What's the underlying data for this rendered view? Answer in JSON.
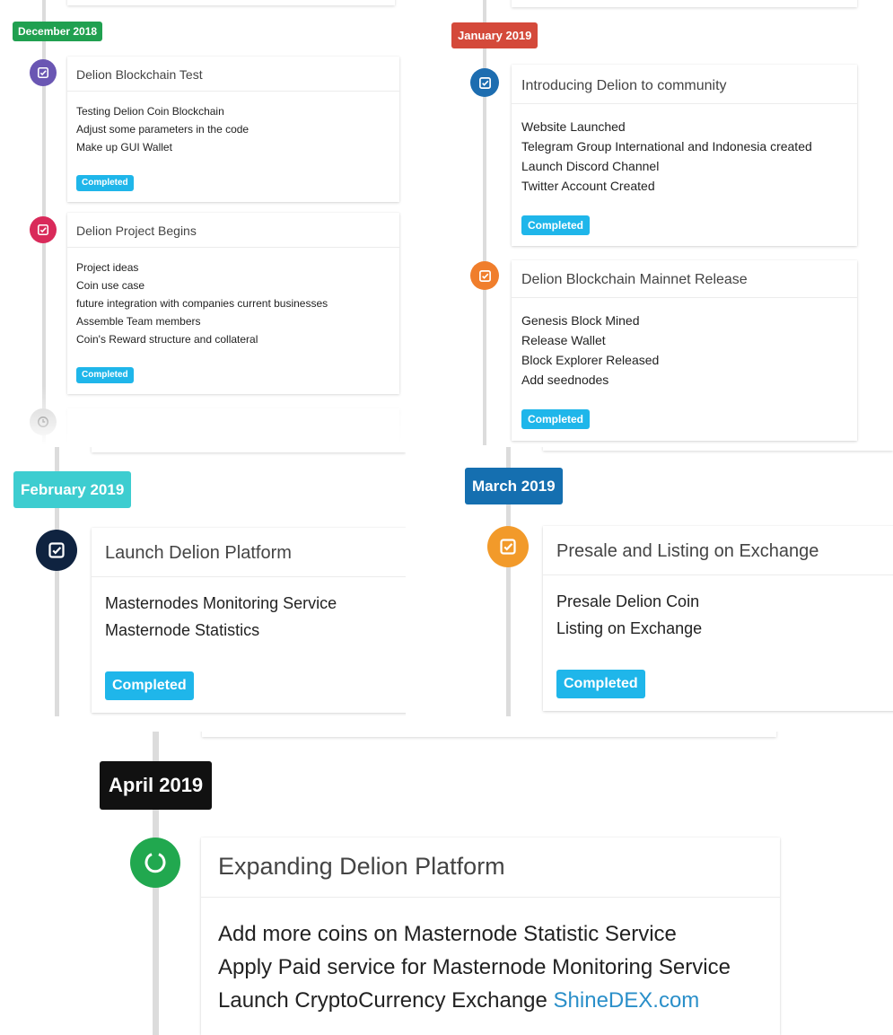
{
  "colors": {
    "december": "#20a050",
    "january": "#d4493a",
    "february": "#3dcdd0",
    "march": "#156fb0",
    "april": "#111111",
    "completed_badge": "#1fb6ea",
    "link": "#2a8fc9"
  },
  "timeline": {
    "december_2018": {
      "month": "December 2018",
      "items": [
        {
          "icon": "check-square-icon",
          "node_color": "#6a56b3",
          "title": "Delion Blockchain Test",
          "lines": [
            "Testing Delion Coin Blockchain",
            "Adjust some parameters in the code",
            "Make up GUI Wallet"
          ],
          "status": "Completed"
        },
        {
          "icon": "check-square-icon",
          "node_color": "#d92a5a",
          "title": "Delion Project Begins",
          "lines": [
            "Project ideas",
            "Coin use case",
            "future integration with companies current businesses",
            "Assemble Team members",
            "Coin's Reward structure and collateral"
          ],
          "status": "Completed"
        }
      ],
      "pending_icon": "clock-icon"
    },
    "january_2019": {
      "month": "January 2019",
      "items": [
        {
          "icon": "check-square-icon",
          "node_color": "#1d6db0",
          "title": "Introducing Delion to community",
          "lines": [
            "Website Launched",
            "Telegram Group International and Indonesia created",
            "Launch Discord Channel",
            "Twitter Account Created"
          ],
          "status": "Completed"
        },
        {
          "icon": "check-square-icon",
          "node_color": "#f07e2c",
          "title": "Delion Blockchain Mainnet Release",
          "lines": [
            "Genesis Block Mined",
            "Release Wallet",
            "Block Explorer Released",
            "Add seednodes"
          ],
          "status": "Completed"
        }
      ]
    },
    "february_2019": {
      "month": "February 2019",
      "items": [
        {
          "icon": "check-square-icon",
          "node_color": "#0f2340",
          "title": "Launch Delion Platform",
          "lines": [
            "Masternodes Monitoring Service",
            "Masternode Statistics"
          ],
          "status": "Completed"
        }
      ]
    },
    "march_2019": {
      "month": "March 2019",
      "items": [
        {
          "icon": "check-square-icon",
          "node_color": "#f29a2a",
          "title": "Presale and Listing on Exchange",
          "lines": [
            "Presale Delion Coin",
            "Listing on Exchange"
          ],
          "status": "Completed"
        }
      ]
    },
    "april_2019": {
      "month": "April 2019",
      "items": [
        {
          "icon": "circle-progress-icon",
          "node_color": "#21a84f",
          "title": "Expanding Delion Platform",
          "lines": [
            "Add more coins on Masternode Statistic Service",
            "Apply Paid service for Masternode Monitoring Service"
          ],
          "last_line_prefix": "Launch CryptoCurrency Exchange ",
          "last_line_link": "ShineDEX.com"
        }
      ]
    }
  }
}
